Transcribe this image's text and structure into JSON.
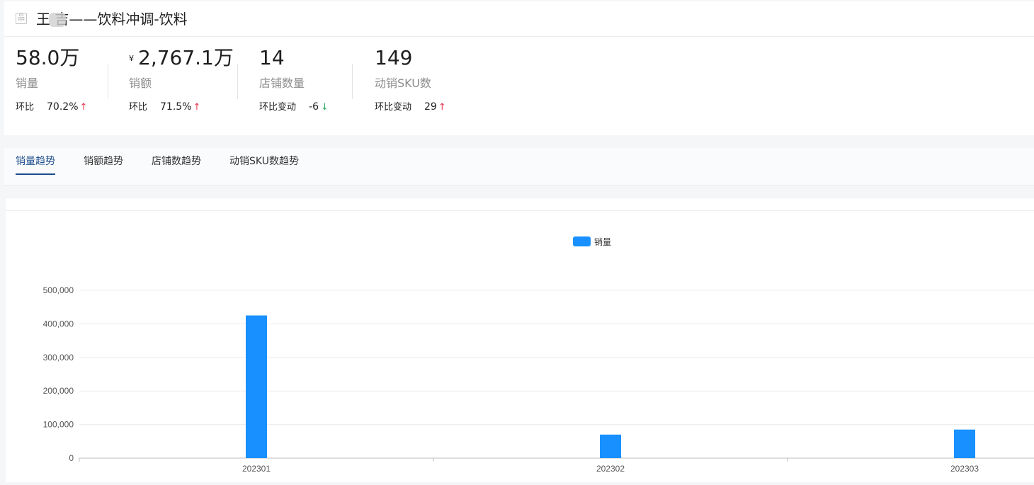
{
  "header": {
    "title_icon": "品",
    "title": "王 吉——饮料冲调-饮料"
  },
  "metrics": [
    {
      "value": "58.0万",
      "currency": "",
      "label": "销量",
      "change_label": "环比",
      "change_value": "70.2%",
      "direction": "up"
    },
    {
      "value": "2,767.1万",
      "currency": "¥",
      "label": "销额",
      "change_label": "环比",
      "change_value": "71.5%",
      "direction": "up"
    },
    {
      "value": "14",
      "currency": "",
      "label": "店铺数量",
      "change_label": "环比变动",
      "change_value": "-6",
      "direction": "down"
    },
    {
      "value": "149",
      "currency": "",
      "label": "动销SKU数",
      "change_label": "环比变动",
      "change_value": "29",
      "direction": "up"
    }
  ],
  "tabs": [
    "销量趋势",
    "销额趋势",
    "店铺数趋势",
    "动销SKU数趋势"
  ],
  "active_tab": 0,
  "icons": {
    "up": "↑",
    "down": "↓"
  },
  "colors": {
    "bar": "#1890ff",
    "up": "#e8344e",
    "down": "#27ae60",
    "active_tab": "#1c4e8c"
  },
  "chart_data": {
    "type": "bar",
    "categories": [
      "202301",
      "202302",
      "202303"
    ],
    "series": [
      {
        "name": "销量",
        "values": [
          425000,
          70000,
          85000
        ]
      }
    ],
    "ylim": [
      0,
      500000
    ],
    "yticks": [
      0,
      100000,
      200000,
      300000,
      400000,
      500000
    ],
    "ytick_labels": [
      "0",
      "100,000",
      "200,000",
      "300,000",
      "400,000",
      "500,000"
    ],
    "legend": "top-center",
    "grid": true
  }
}
